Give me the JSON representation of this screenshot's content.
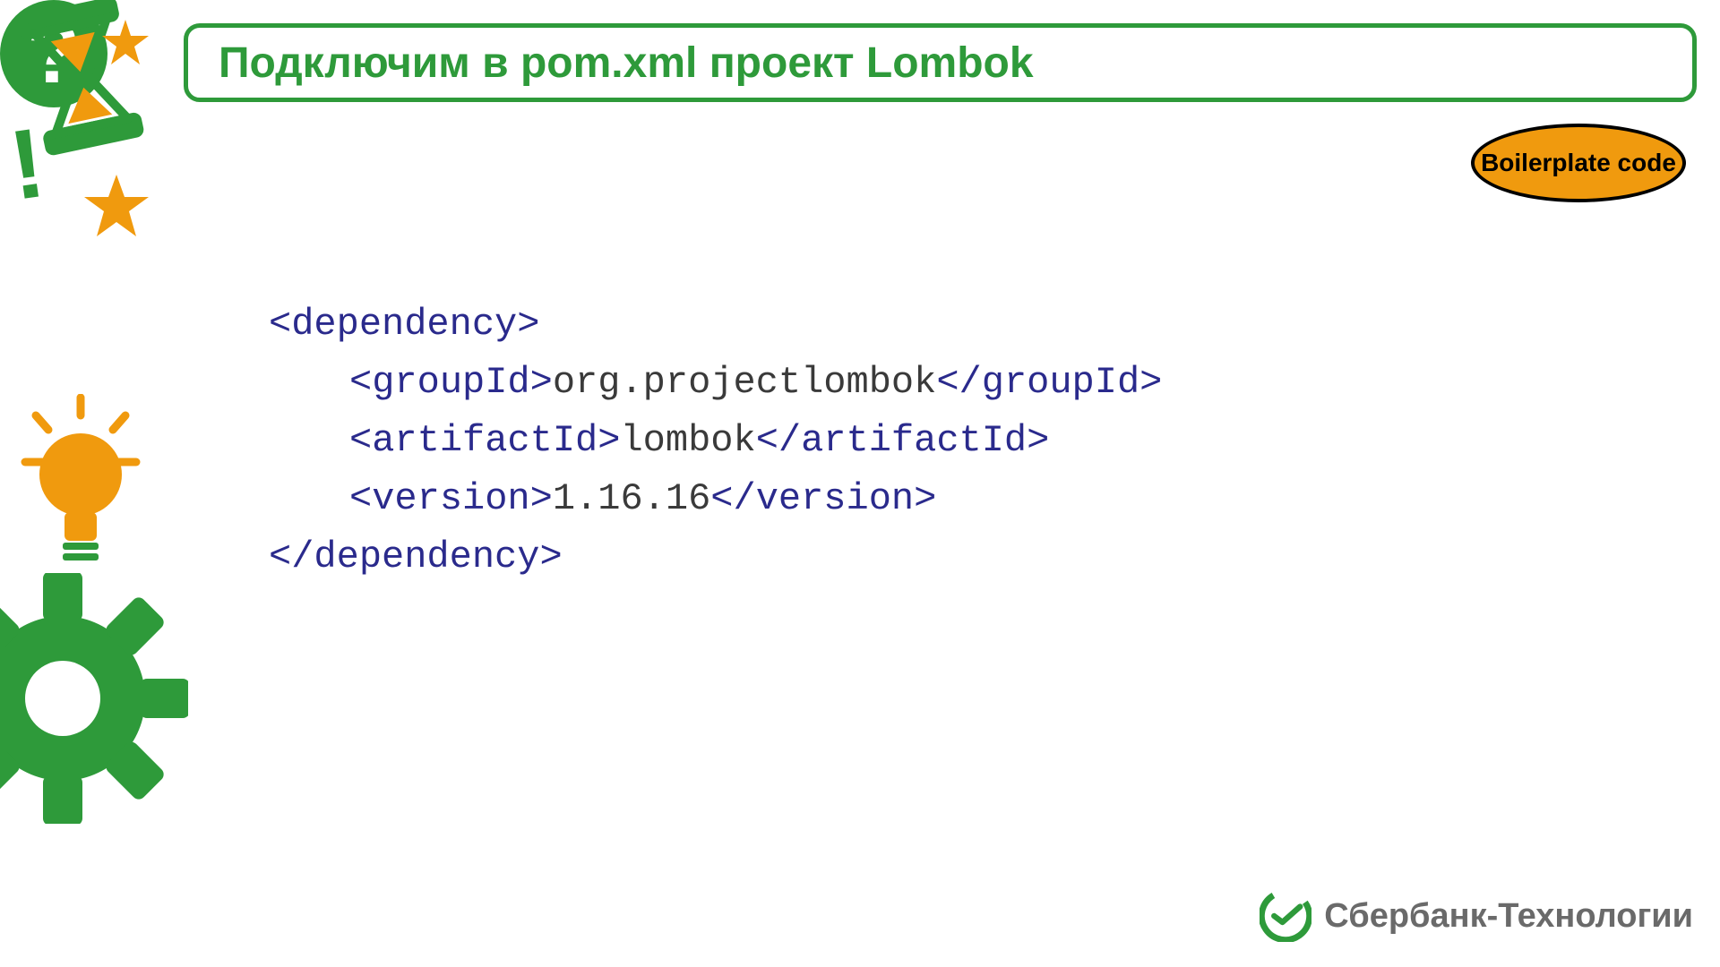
{
  "title": "Подключим в pom.xml проект Lombok",
  "badge": "Boilerplate code",
  "code": {
    "dep_open": "<dependency>",
    "group_open": "<groupId>",
    "group_text": "org.projectlombok",
    "group_close": "</groupId>",
    "art_open": "<artifactId>",
    "art_text": "lombok",
    "art_close": "</artifactId>",
    "ver_open": "<version>",
    "ver_text": "1.16.16",
    "ver_close": "</version>",
    "dep_close": "</dependency>"
  },
  "footer": "Сбербанк-Технологии",
  "colors": {
    "green": "#2e9a3a",
    "orange": "#f09a0e",
    "grey": "#6a6a6a",
    "xml_tag": "#2a2a8c"
  }
}
